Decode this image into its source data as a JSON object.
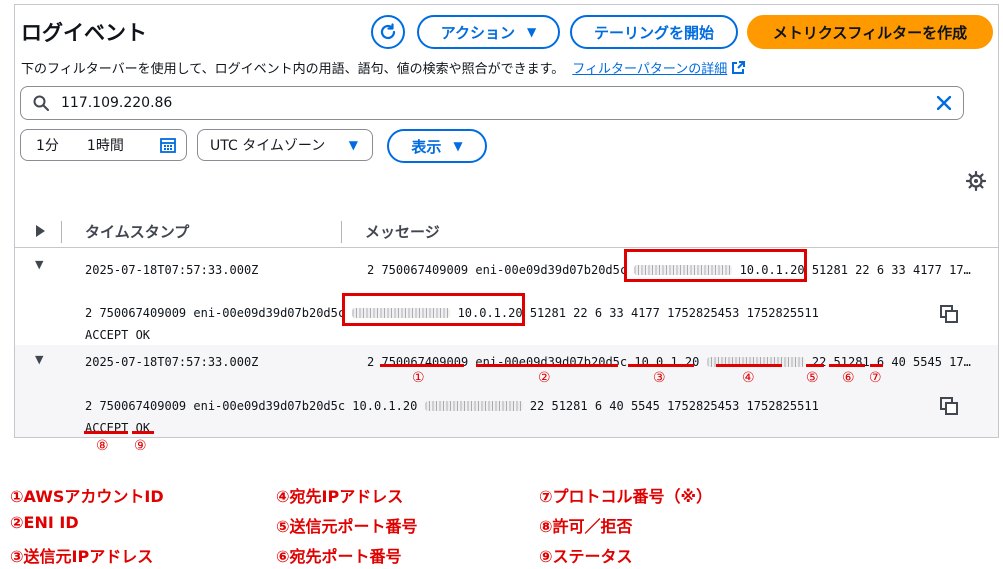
{
  "header": {
    "title": "ログイベント",
    "action_label": "アクション",
    "tail_label": "テーリングを開始",
    "metric_filter_label": "メトリクスフィルターを作成"
  },
  "description": {
    "text": "下のフィルターバーを使用して、ログイベント内の用語、語句、値の検索や照合ができます。",
    "link": "フィルターパターンの詳細"
  },
  "search": {
    "value": "117.109.220.86"
  },
  "toolbar": {
    "range_1": "1分",
    "range_2": "1時間",
    "timezone": "UTC タイムゾーン",
    "display_label": "表示"
  },
  "table": {
    "col_timestamp": "タイムスタンプ",
    "col_message": "メッセージ",
    "rows": [
      {
        "timestamp": "2025-07-18T07:57:33.000Z",
        "msg_prefix": "2 750067409009 eni-00e09d39d07b20d5c",
        "msg_ip": "10.0.1.20",
        "msg_suffix": "51281 22 6 33 4177 17…",
        "detail_prefix": "2 750067409009 eni-00e09d39d07b20d5c",
        "detail_ip": "10.0.1.20",
        "detail_suffix": "51281 22 6 33 4177 1752825453 1752825511",
        "detail_line2": "ACCEPT OK"
      },
      {
        "timestamp": "2025-07-18T07:57:33.000Z",
        "f_version": "2",
        "f_account": "750067409009",
        "f_eni": "eni-00e09d39d07b20d5c",
        "f_srcip": "10.0.1.20",
        "f_dstport": "22",
        "f_srcport": "51281",
        "f_proto": "6",
        "f_rest": "40 5545 17…",
        "detail_prefix": "2 750067409009 eni-00e09d39d07b20d5c 10.0.1.20",
        "detail_suffix": "22 51281 6 40 5545 1752825453 1752825511",
        "detail_action": "ACCEPT",
        "detail_status": "OK"
      }
    ]
  },
  "markers": [
    "①",
    "②",
    "③",
    "④",
    "⑤",
    "⑥",
    "⑦",
    "⑧",
    "⑨"
  ],
  "legend": [
    "①AWSアカウントID",
    "②ENI ID",
    "③送信元IPアドレス",
    "④宛先IPアドレス",
    "⑤送信元ポート番号",
    "⑥宛先ポート番号",
    "⑦プロトコル番号（※）",
    "⑧許可／拒否",
    "⑨ステータス"
  ],
  "colors": {
    "accent": "#006ce0",
    "primary": "#ff9900",
    "annotation": "#e00000"
  }
}
